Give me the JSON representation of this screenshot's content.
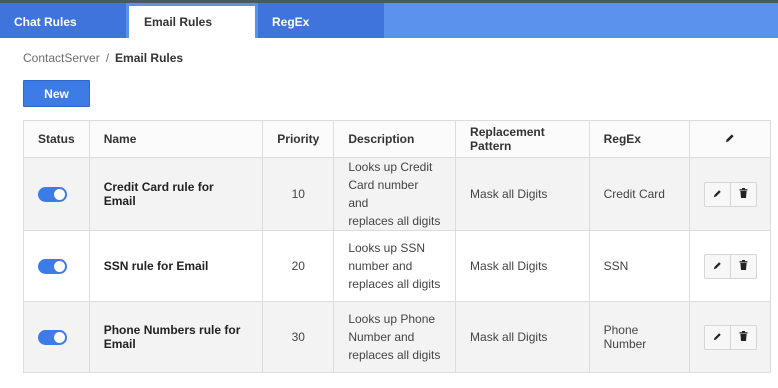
{
  "tabs": [
    {
      "label": "Chat Rules"
    },
    {
      "label": "Email Rules"
    },
    {
      "label": "RegEx"
    }
  ],
  "breadcrumb": {
    "parent": "ContactServer",
    "separator": "/",
    "current": "Email Rules"
  },
  "toolbar": {
    "new_label": "New"
  },
  "table": {
    "headers": {
      "status": "Status",
      "name": "Name",
      "priority": "Priority",
      "description": "Description",
      "replacement": "Replacement Pattern",
      "regex": "RegEx"
    },
    "rows": [
      {
        "enabled": true,
        "name": "Credit Card rule for Email",
        "priority": "10",
        "description": [
          "Looks up Credit",
          "Card number and",
          "replaces all digits"
        ],
        "replacement": "Mask all Digits",
        "regex": "Credit Card"
      },
      {
        "enabled": true,
        "name": "SSN rule for Email",
        "priority": "20",
        "description": [
          "Looks up SSN",
          "number and",
          "replaces all digits"
        ],
        "replacement": "Mask all Digits",
        "regex": "SSN"
      },
      {
        "enabled": true,
        "name": "Phone Numbers rule for Email",
        "priority": "30",
        "description": [
          "Looks up Phone",
          "Number and",
          "replaces all digits"
        ],
        "replacement": "Mask all Digits",
        "regex": "Phone Number"
      }
    ]
  },
  "colors": {
    "accent": "#3d7be6",
    "tabbar": "#5b92ee",
    "tab_inactive": "#3f74dc"
  },
  "icons": {
    "header_action": "pencil-icon",
    "row_edit": "pencil-icon",
    "row_delete": "trash-icon"
  }
}
